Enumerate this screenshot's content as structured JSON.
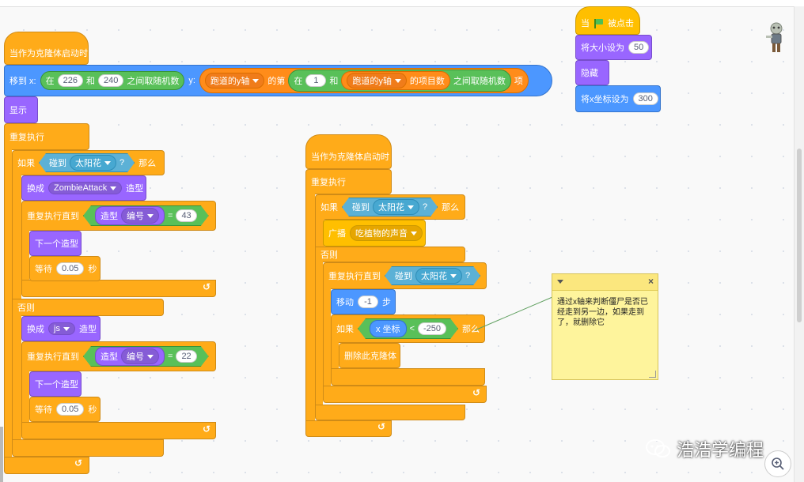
{
  "stage": {
    "sprite_icon": "zombie-sprite-icon",
    "zoom_icon": "zoom-in-icon",
    "watermark": "浩浩学编程"
  },
  "green_flag_script": {
    "hat_when": "当",
    "hat_clicked": "被点击",
    "set_size_label": "将大小设为",
    "set_size_value": "50",
    "hide_label": "隐藏",
    "set_x_label": "将x坐标设为",
    "set_x_value": "300"
  },
  "clone_script_1": {
    "hat": "当作为克隆体启动时",
    "goto_x_label": "移到 x:",
    "rand_in": "在",
    "rand_and": "和",
    "rand_pick": "之间取随机数",
    "rand1_from": "226",
    "rand1_to": "240",
    "goto_y_label": "y:",
    "list_name": "跑道的y轴",
    "list_item_of": "的第",
    "rand2_from": "1",
    "list_length_of": "的项目数",
    "item_suffix": "项",
    "show": "显示",
    "forever": "重复执行",
    "if": "如果",
    "touching": "碰到",
    "touching_target": "太阳花",
    "question": "?",
    "then": "那么",
    "switch_costume": "换成",
    "costume_a": "ZombieAttack",
    "costume_suffix": "造型",
    "repeat_until": "重复执行直到",
    "costume_reporter": "造型",
    "costume_field": "编号",
    "equals": "=",
    "until_value_a": "43",
    "next_costume": "下一个造型",
    "wait": "等待",
    "wait_value": "0.05",
    "seconds": "秒",
    "else": "否则",
    "costume_b": "js",
    "until_value_b": "22"
  },
  "clone_script_2": {
    "hat": "当作为克隆体启动时",
    "forever": "重复执行",
    "if": "如果",
    "touching": "碰到",
    "touching_target": "太阳花",
    "question": "?",
    "then": "那么",
    "broadcast": "广播",
    "broadcast_message": "吃植物的声音",
    "else": "否则",
    "repeat_until": "重复执行直到",
    "move": "移动",
    "move_value": "-1",
    "steps": "步",
    "x_position": "x 坐标",
    "less_than": "<",
    "compare_value": "-250",
    "delete_clone": "删除此克隆体"
  },
  "comment": {
    "text": "通过x轴来判断僵尸是否已经走到另一边，如果走到了，就删除它",
    "close": "×"
  },
  "colors": {
    "events": "#ffbf00",
    "control": "#ffab19",
    "motion": "#4c97ff",
    "looks": "#9966ff",
    "sensing": "#5cb1d6",
    "operators": "#59c059",
    "variables": "#ff8c1a",
    "comment": "#fef49c"
  }
}
